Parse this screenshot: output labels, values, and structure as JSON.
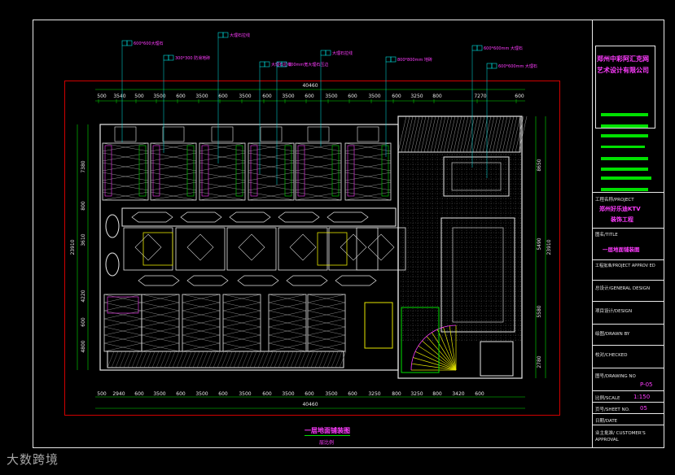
{
  "company": {
    "line1": "郑州中彩阿汇克网",
    "line2": "艺术设计有限公司"
  },
  "title_block": {
    "project_label": "工程名称/PROJECT",
    "project_value_1": "郑州好乐迪KTV",
    "project_value_2": "装饰工程",
    "title_label": "图名/TITLE",
    "title_value": "一层地面铺装图",
    "approved_label": "工程批准/PROJECT APPROV ED",
    "general_label": "总设计/GENERAL DESIGN",
    "design_label": "项目设计/DESIGN",
    "drawn_label": "绘图/DRAWN BY",
    "checked_label": "校对/CHECKED",
    "drawing_no_label": "图号/DRAWING NO",
    "drawing_no_value": "P-05",
    "scale_label": "比例/SCALE",
    "scale_value": "1:150",
    "sheet_label": "页号/SHEET NO.",
    "sheet_value": "05",
    "date_label": "日期/DATE",
    "approval_label": "业主批准/ CUSTOMER'S APPROVAL"
  },
  "drawing": {
    "total_top": "40460",
    "total_bottom": "40460",
    "top_dims": [
      "500",
      "3540",
      "500",
      "3500",
      "600",
      "3500",
      "600",
      "3500",
      "600",
      "3500",
      "600",
      "3500",
      "600",
      "3500",
      "600",
      "3250",
      "800",
      "7270",
      "600"
    ],
    "bottom_dims": [
      "500",
      "2940",
      "600",
      "3500",
      "600",
      "3500",
      "600",
      "3500",
      "600",
      "3500",
      "600",
      "3500",
      "600",
      "3250",
      "800",
      "3250",
      "800",
      "3420",
      "600"
    ],
    "left_dims": [
      "7380",
      "800",
      "3610",
      "4220",
      "600",
      "4800"
    ],
    "left_total": "23910",
    "right_dims": [
      "8650",
      "5490",
      "5580",
      "2780"
    ],
    "right_total": "23910",
    "caption": "一层地面铺装图",
    "caption_sub": "层比例",
    "notes": [
      "600*600大理石",
      "300*300 防滑地砖",
      "大理石拉线",
      "大理石拉线",
      "100mm宽大理石压边",
      "大理石拉线",
      "800*800mm 地砖",
      "600*600mm 大理石",
      "600*600mm 大理石"
    ]
  },
  "watermark": "大数跨境"
}
